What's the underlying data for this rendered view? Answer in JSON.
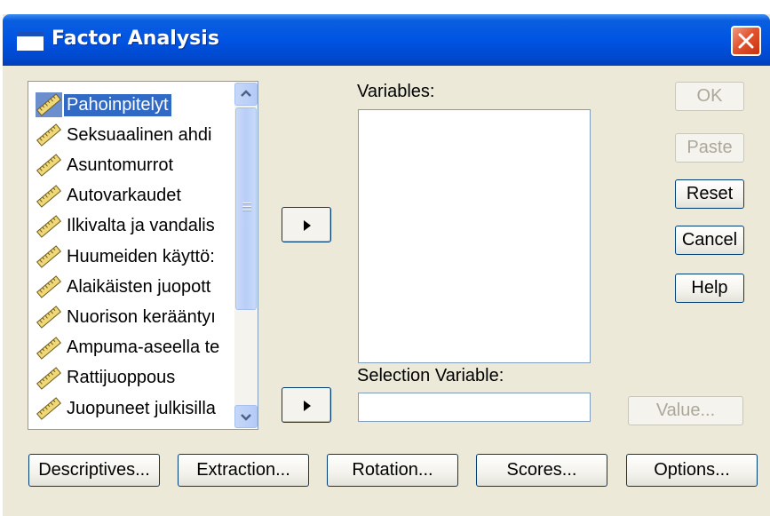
{
  "window": {
    "title": "Factor Analysis",
    "icon": "window-icon",
    "close_icon": "close-icon"
  },
  "source_list": {
    "items": [
      "Pahoinpitelyt",
      "Seksuaalinen ahdi",
      "Asuntomurrot",
      "Autovarkaudet",
      "Ilkivalta ja vandalis",
      "Huumeiden käyttö:",
      "Alaikäisten juopott",
      "Nuorison kerääntyı",
      "Ampuma-aseella te",
      "Rattijuoppous",
      "Juopuneet julkisilla"
    ],
    "selected_index": 0,
    "item_icon": "scale-variable-icon"
  },
  "variables": {
    "label": "Variables:"
  },
  "selection_variable": {
    "label": "Selection Variable:",
    "value": ""
  },
  "side_buttons": {
    "ok": "OK",
    "paste": "Paste",
    "reset": "Reset",
    "cancel": "Cancel",
    "help": "Help",
    "value": "Value..."
  },
  "bottom_buttons": {
    "descriptives": "Descriptives...",
    "extraction": "Extraction...",
    "rotation": "Rotation...",
    "scores": "Scores...",
    "options": "Options..."
  },
  "colors": {
    "title_bar": "#0054e3",
    "dialog_bg": "#ece9d8",
    "selection": "#316ac5",
    "close_button": "#e2542f"
  }
}
